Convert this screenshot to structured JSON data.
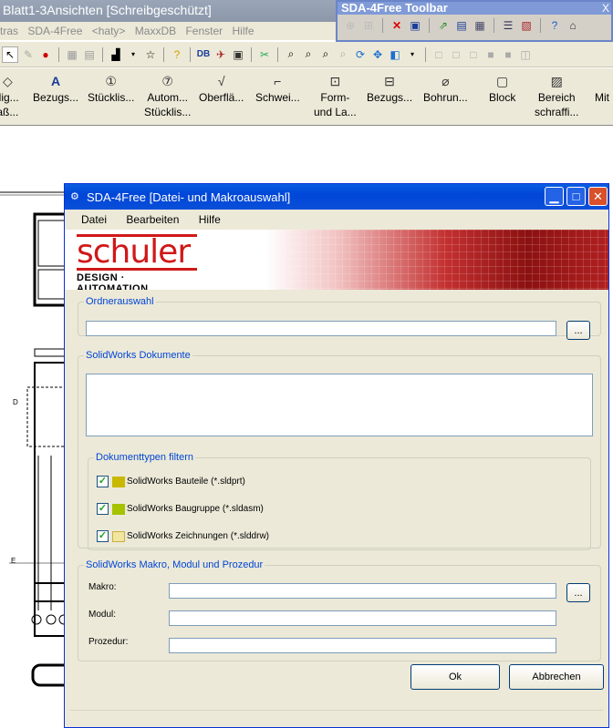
{
  "app": {
    "title": "Blatt1-3Ansichten [Schreibgeschützt]"
  },
  "float_toolbar": {
    "title": "SDA-4Free Toolbar",
    "close": "X"
  },
  "menubar": [
    "tras",
    "SDA-4Free",
    "<haty>",
    "MaxxDB",
    "Fenster",
    "Hilfe"
  ],
  "command_manager": [
    {
      "icon": "dimension-icon",
      "line1": "llig...",
      "line2": "aß..."
    },
    {
      "icon": "annotation-icon",
      "line1": "Bezugs...",
      "line2": ""
    },
    {
      "icon": "balloon-icon",
      "line1": "Stücklis...",
      "line2": ""
    },
    {
      "icon": "auto-balloon-icon",
      "line1": "Autom...",
      "line2": "Stücklis..."
    },
    {
      "icon": "surface-finish-icon",
      "line1": "Oberflä...",
      "line2": ""
    },
    {
      "icon": "weld-icon",
      "line1": "Schwei...",
      "line2": ""
    },
    {
      "icon": "geometric-tolerance-icon",
      "line1": "Form-",
      "line2": "und La..."
    },
    {
      "icon": "datum-feature-icon",
      "line1": "Bezugs...",
      "line2": ""
    },
    {
      "icon": "hole-callout-icon",
      "line1": "Bohrun...",
      "line2": ""
    },
    {
      "icon": "block-icon",
      "line1": "Block",
      "line2": ""
    },
    {
      "icon": "area-hatch-icon",
      "line1": "Bereich",
      "line2": "schraffi..."
    },
    {
      "icon": "center-icon",
      "line1": "Mit",
      "line2": ""
    }
  ],
  "dialog": {
    "title": "SDA-4Free [Datei- und Makroauswahl]",
    "menu": [
      "Datei",
      "Bearbeiten",
      "Hilfe"
    ],
    "brand": {
      "name": "schuler",
      "tagline": "DESIGN · AUTOMATION"
    },
    "folder": {
      "legend": "Ordnerauswahl",
      "value": "",
      "browse": "..."
    },
    "documents": {
      "legend": "SolidWorks Dokumente"
    },
    "filter": {
      "legend": "Dokumenttypen filtern",
      "items": [
        {
          "label": "SolidWorks Bauteile (*.sldprt)",
          "checked": true,
          "icon": "part-icon"
        },
        {
          "label": "SolidWorks Baugruppe (*.sldasm)",
          "checked": true,
          "icon": "assembly-icon"
        },
        {
          "label": "SolidWorks Zeichnungen (*.slddrw)",
          "checked": true,
          "icon": "drawing-icon"
        }
      ]
    },
    "macro": {
      "legend": "SolidWorks Makro, Modul und Prozedur",
      "macro_label": "Makro:",
      "module_label": "Modul:",
      "procedure_label": "Prozedur:",
      "browse": "..."
    },
    "ok": "Ok",
    "cancel": "Abbrechen"
  }
}
